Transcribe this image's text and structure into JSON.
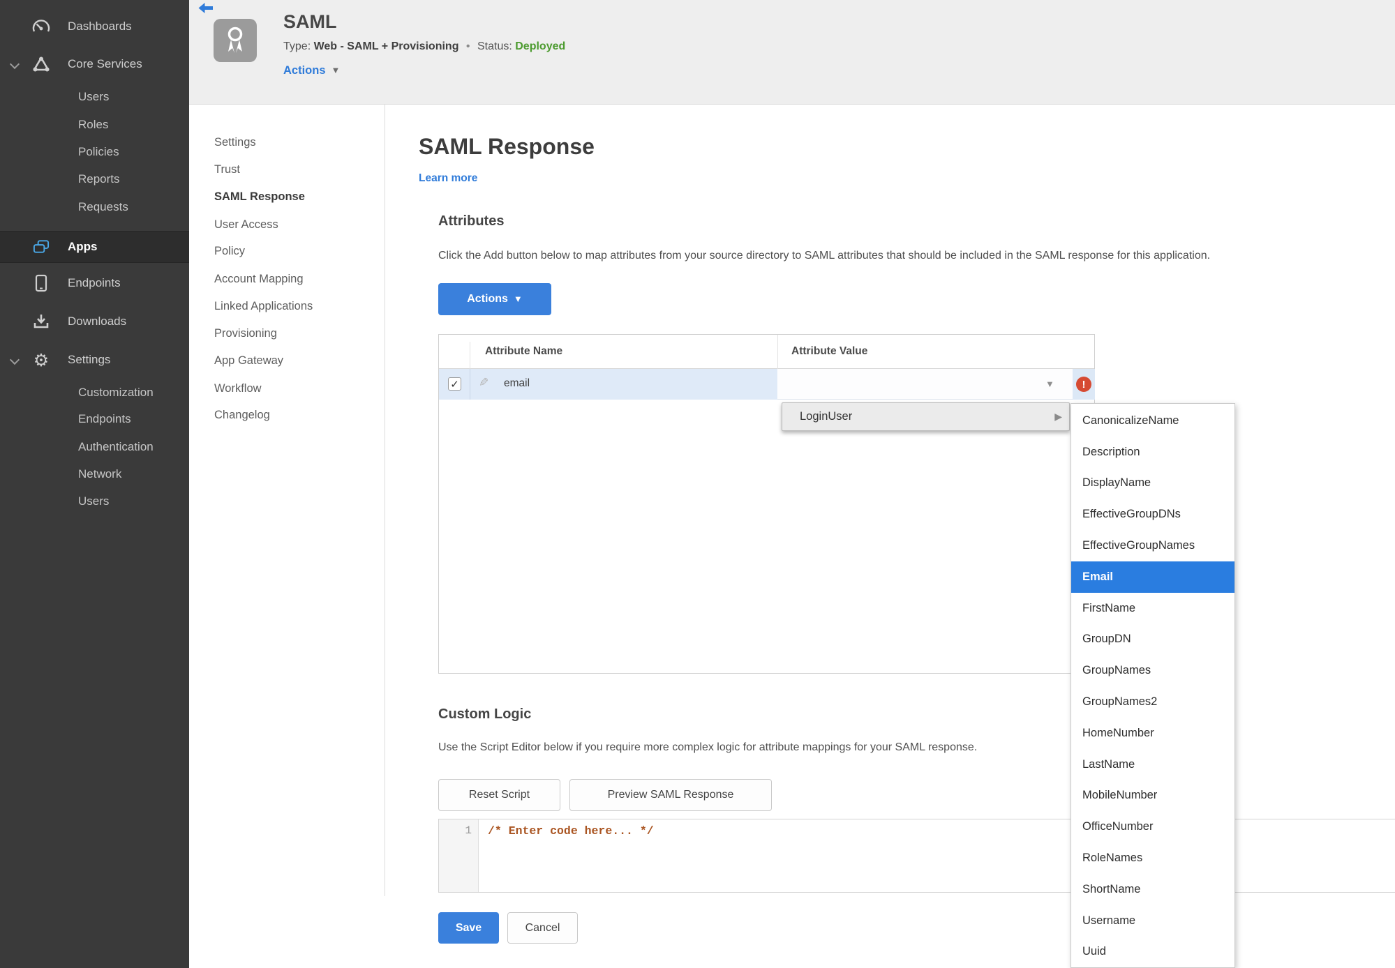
{
  "colors": {
    "accent_blue": "#2f7bd9",
    "button_blue": "#3a80dc",
    "selection_blue": "#2a7de0",
    "status_green": "#4c9b2f",
    "error_red": "#d64a32",
    "row_highlight": "#dfeaf8",
    "sidebar_bg": "#3a3a3a"
  },
  "sidebar": {
    "items": [
      {
        "label": "Dashboards",
        "icon": "gauge-icon",
        "level": 0
      },
      {
        "label": "Core Services",
        "icon": "core-services-icon",
        "level": 0,
        "expanded": true
      },
      {
        "label": "Users",
        "level": 1
      },
      {
        "label": "Roles",
        "level": 1
      },
      {
        "label": "Policies",
        "level": 1
      },
      {
        "label": "Reports",
        "level": 1
      },
      {
        "label": "Requests",
        "level": 1
      },
      {
        "label": "Apps",
        "icon": "apps-icon",
        "level": 0,
        "active": true
      },
      {
        "label": "Endpoints",
        "icon": "phone-icon",
        "level": 0
      },
      {
        "label": "Downloads",
        "icon": "download-icon",
        "level": 0
      },
      {
        "label": "Settings",
        "icon": "gear-icon",
        "level": 0,
        "expanded": true
      },
      {
        "label": "Customization",
        "level": 1
      },
      {
        "label": "Endpoints",
        "level": 1
      },
      {
        "label": "Authentication",
        "level": 1
      },
      {
        "label": "Network",
        "level": 1
      },
      {
        "label": "Users",
        "level": 1
      }
    ]
  },
  "header": {
    "app_name": "SAML",
    "type_label": "Type:",
    "type_value": "Web - SAML + Provisioning",
    "separator": "•",
    "status_label": "Status:",
    "status_value": "Deployed",
    "actions_label": "Actions"
  },
  "subnav": {
    "items": [
      {
        "label": "Settings"
      },
      {
        "label": "Trust"
      },
      {
        "label": "SAML Response",
        "active": true
      },
      {
        "label": "User Access"
      },
      {
        "label": "Policy"
      },
      {
        "label": "Account Mapping"
      },
      {
        "label": "Linked Applications"
      },
      {
        "label": "Provisioning"
      },
      {
        "label": "App Gateway"
      },
      {
        "label": "Workflow"
      },
      {
        "label": "Changelog"
      }
    ]
  },
  "main": {
    "title": "SAML Response",
    "learn_more": "Learn more",
    "attributes": {
      "heading": "Attributes",
      "description": "Click the Add button below to map attributes from your source directory to SAML attributes that should be included in the SAML response for this application.",
      "actions_button": "Actions",
      "table": {
        "columns": [
          "Attribute Name",
          "Attribute Value"
        ],
        "rows": [
          {
            "name": "email",
            "value": "",
            "checked": true,
            "error": true
          }
        ]
      }
    },
    "custom_logic": {
      "heading": "Custom Logic",
      "description": "Use the Script Editor below if you require more complex logic for attribute mappings for your SAML response.",
      "reset_button": "Reset Script",
      "preview_button": "Preview SAML Response",
      "editor": {
        "line_number": "1",
        "code": "/* Enter code here... */"
      }
    },
    "save_button": "Save",
    "cancel_button": "Cancel"
  },
  "menus": {
    "context": {
      "label": "LoginUser"
    },
    "submenu": {
      "selected": "Email",
      "items": [
        "CanonicalizeName",
        "Description",
        "DisplayName",
        "EffectiveGroupDNs",
        "EffectiveGroupNames",
        "Email",
        "FirstName",
        "GroupDN",
        "GroupNames",
        "GroupNames2",
        "HomeNumber",
        "LastName",
        "MobileNumber",
        "OfficeNumber",
        "RoleNames",
        "ShortName",
        "Username",
        "Uuid"
      ]
    }
  }
}
